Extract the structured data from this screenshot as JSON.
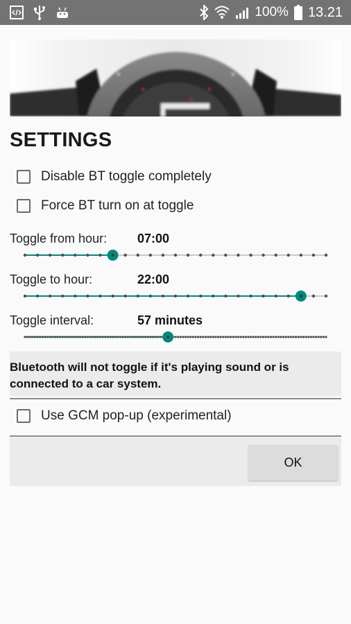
{
  "status_bar": {
    "left_icons": [
      "code-icon",
      "usb-icon",
      "android-icon"
    ],
    "right_icons": [
      "bluetooth-icon",
      "wifi-icon",
      "cell-signal-icon",
      "battery-icon"
    ],
    "battery": "100%",
    "time": "13.21"
  },
  "header": {
    "title": "SETTINGS"
  },
  "options": {
    "disable_bt": {
      "label": "Disable BT toggle completely",
      "checked": false
    },
    "force_bt": {
      "label": "Force BT turn on at toggle",
      "checked": false
    },
    "use_gcm": {
      "label": "Use GCM pop-up (experimental)",
      "checked": false
    }
  },
  "sliders": {
    "from_hour": {
      "label": "Toggle from hour:",
      "value": "07:00",
      "position": 7,
      "steps": 24
    },
    "to_hour": {
      "label": "Toggle to hour:",
      "value": "22:00",
      "position": 22,
      "steps": 24
    },
    "interval": {
      "label": "Toggle interval:",
      "value": "57 minutes",
      "position": 57,
      "steps": 120
    }
  },
  "notice": {
    "text": "Bluetooth will not toggle if it's playing sound or is connected to a car system."
  },
  "actions": {
    "ok_label": "OK"
  },
  "colors": {
    "accent": "#00897b",
    "status_bar": "#737373",
    "inactive_track": "#c8c8c8"
  }
}
